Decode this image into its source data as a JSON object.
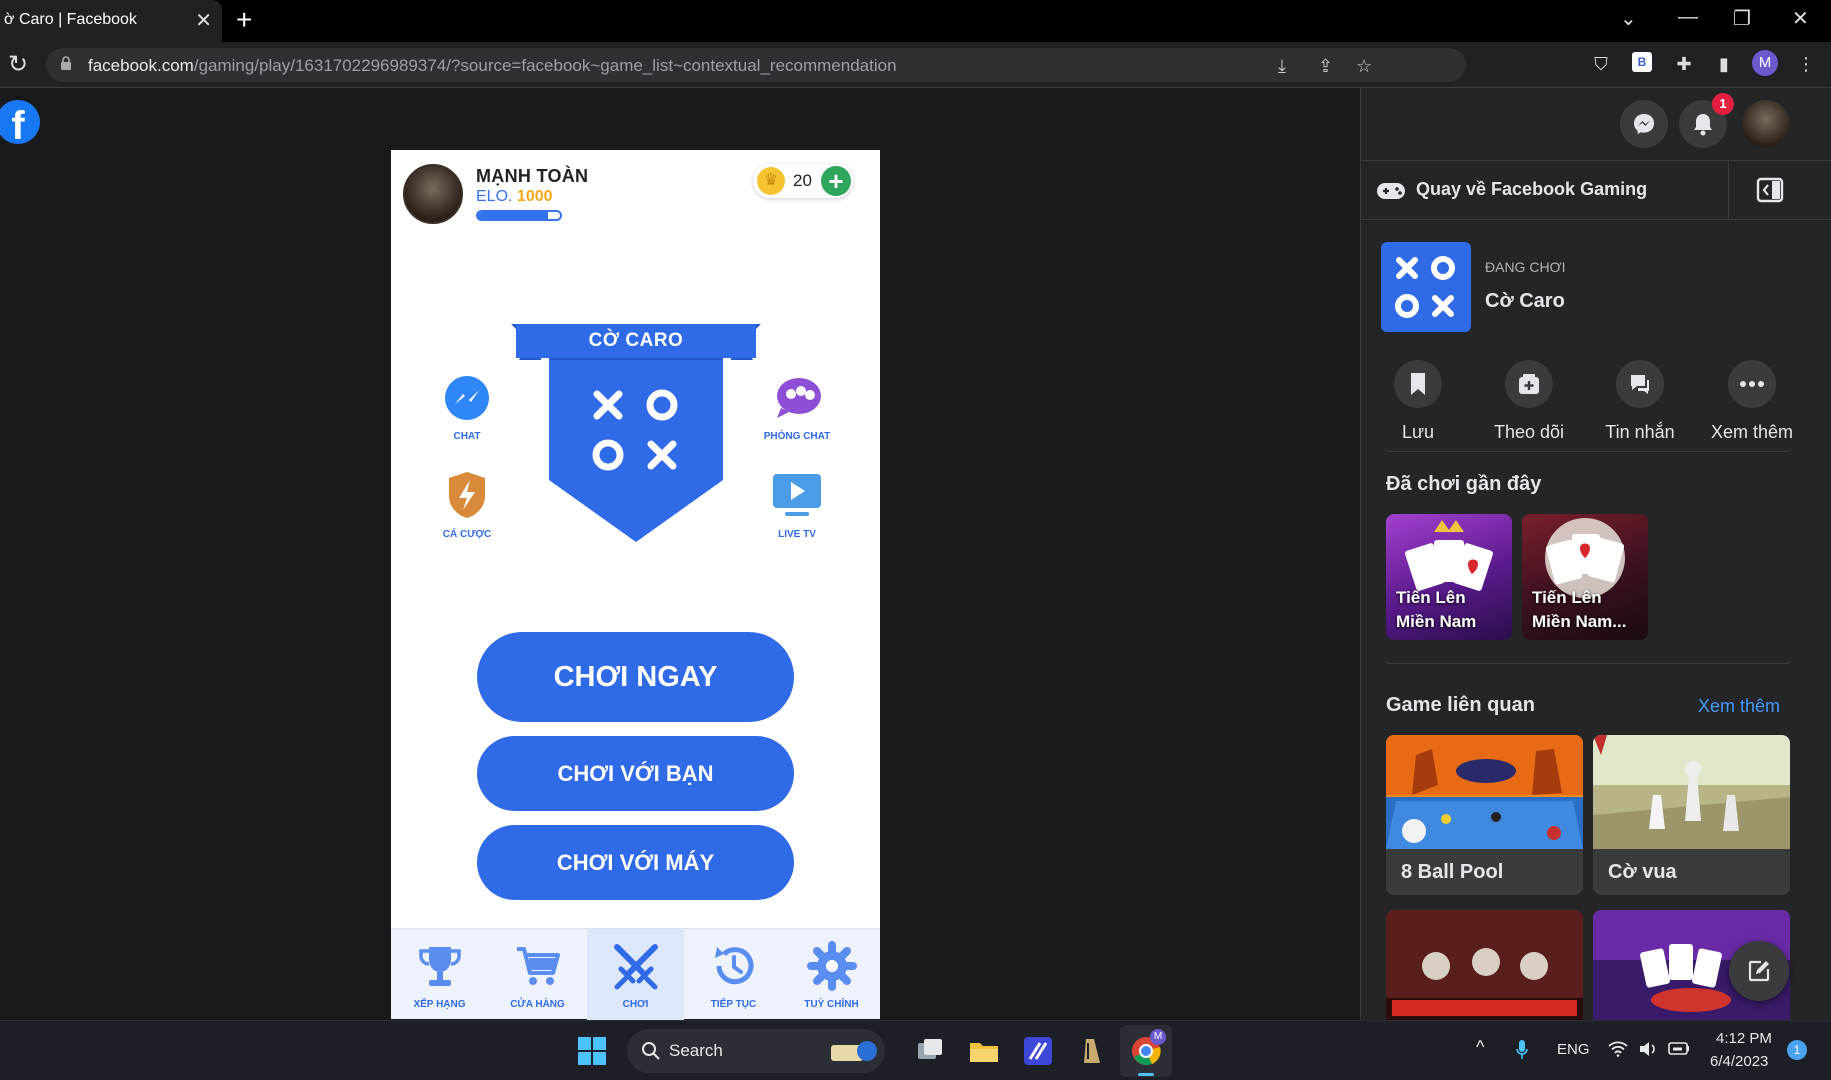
{
  "browser": {
    "tab_title": "ờ Caro | Facebook",
    "tab_close": "✕",
    "new_tab": "+",
    "url_domain": "facebook.com",
    "url_path": "/gaming/play/1631702296989374/?source=facebook~game_list~contextual_recommendation",
    "profile_initial": "M"
  },
  "game": {
    "player_name": "MẠNH TOÀN",
    "elo_label": "ELO.",
    "elo_value": "1000",
    "elo_progress": 0.85,
    "coins": "20",
    "banner_title": "CỜ CARO",
    "side_buttons": {
      "chat": "CHAT",
      "chat_room": "PHÒNG CHAT",
      "betting": "CÁ CƯỢC",
      "live_tv": "LIVE TV"
    },
    "buttons": {
      "play_now": "CHƠI NGAY",
      "play_friend": "CHƠI VỚI BẠN",
      "play_bot": "CHƠI VỚI MÁY"
    },
    "nav": [
      {
        "label": "XẾP HẠNG",
        "icon": "trophy-icon"
      },
      {
        "label": "CỬA HÀNG",
        "icon": "cart-icon"
      },
      {
        "label": "CHƠI",
        "icon": "swords-icon"
      },
      {
        "label": "TIẾP TỤC",
        "icon": "history-icon"
      },
      {
        "label": "TUỲ CHỈNH",
        "icon": "gear-icon"
      }
    ]
  },
  "sidebar": {
    "notification_count": "1",
    "back_label": "Quay về Facebook Gaming",
    "now_playing_label": "ĐANG CHƠI",
    "now_playing_title": "Cờ Caro",
    "actions": [
      "Lưu",
      "Theo dõi",
      "Tin nhắn",
      "Xem thêm"
    ],
    "recent_title": "Đã chơi gần đây",
    "recent_games": [
      {
        "line1": "Tiến Lên",
        "line2": "Miền Nam"
      },
      {
        "line1": "Tiến Lên",
        "line2": "Miền Nam..."
      }
    ],
    "related_title": "Game liên quan",
    "related_see_more": "Xem thêm",
    "related_games": [
      "8 Ball Pool",
      "Cờ vua"
    ]
  },
  "taskbar": {
    "search_label": "Search",
    "lang": "ENG",
    "time": "4:12 PM",
    "date": "6/4/2023",
    "notification_count": "1"
  },
  "colors": {
    "accent": "#2f6be6",
    "facebook_blue": "#1877f2",
    "sidebar_bg": "#242526",
    "link": "#4599ff"
  }
}
